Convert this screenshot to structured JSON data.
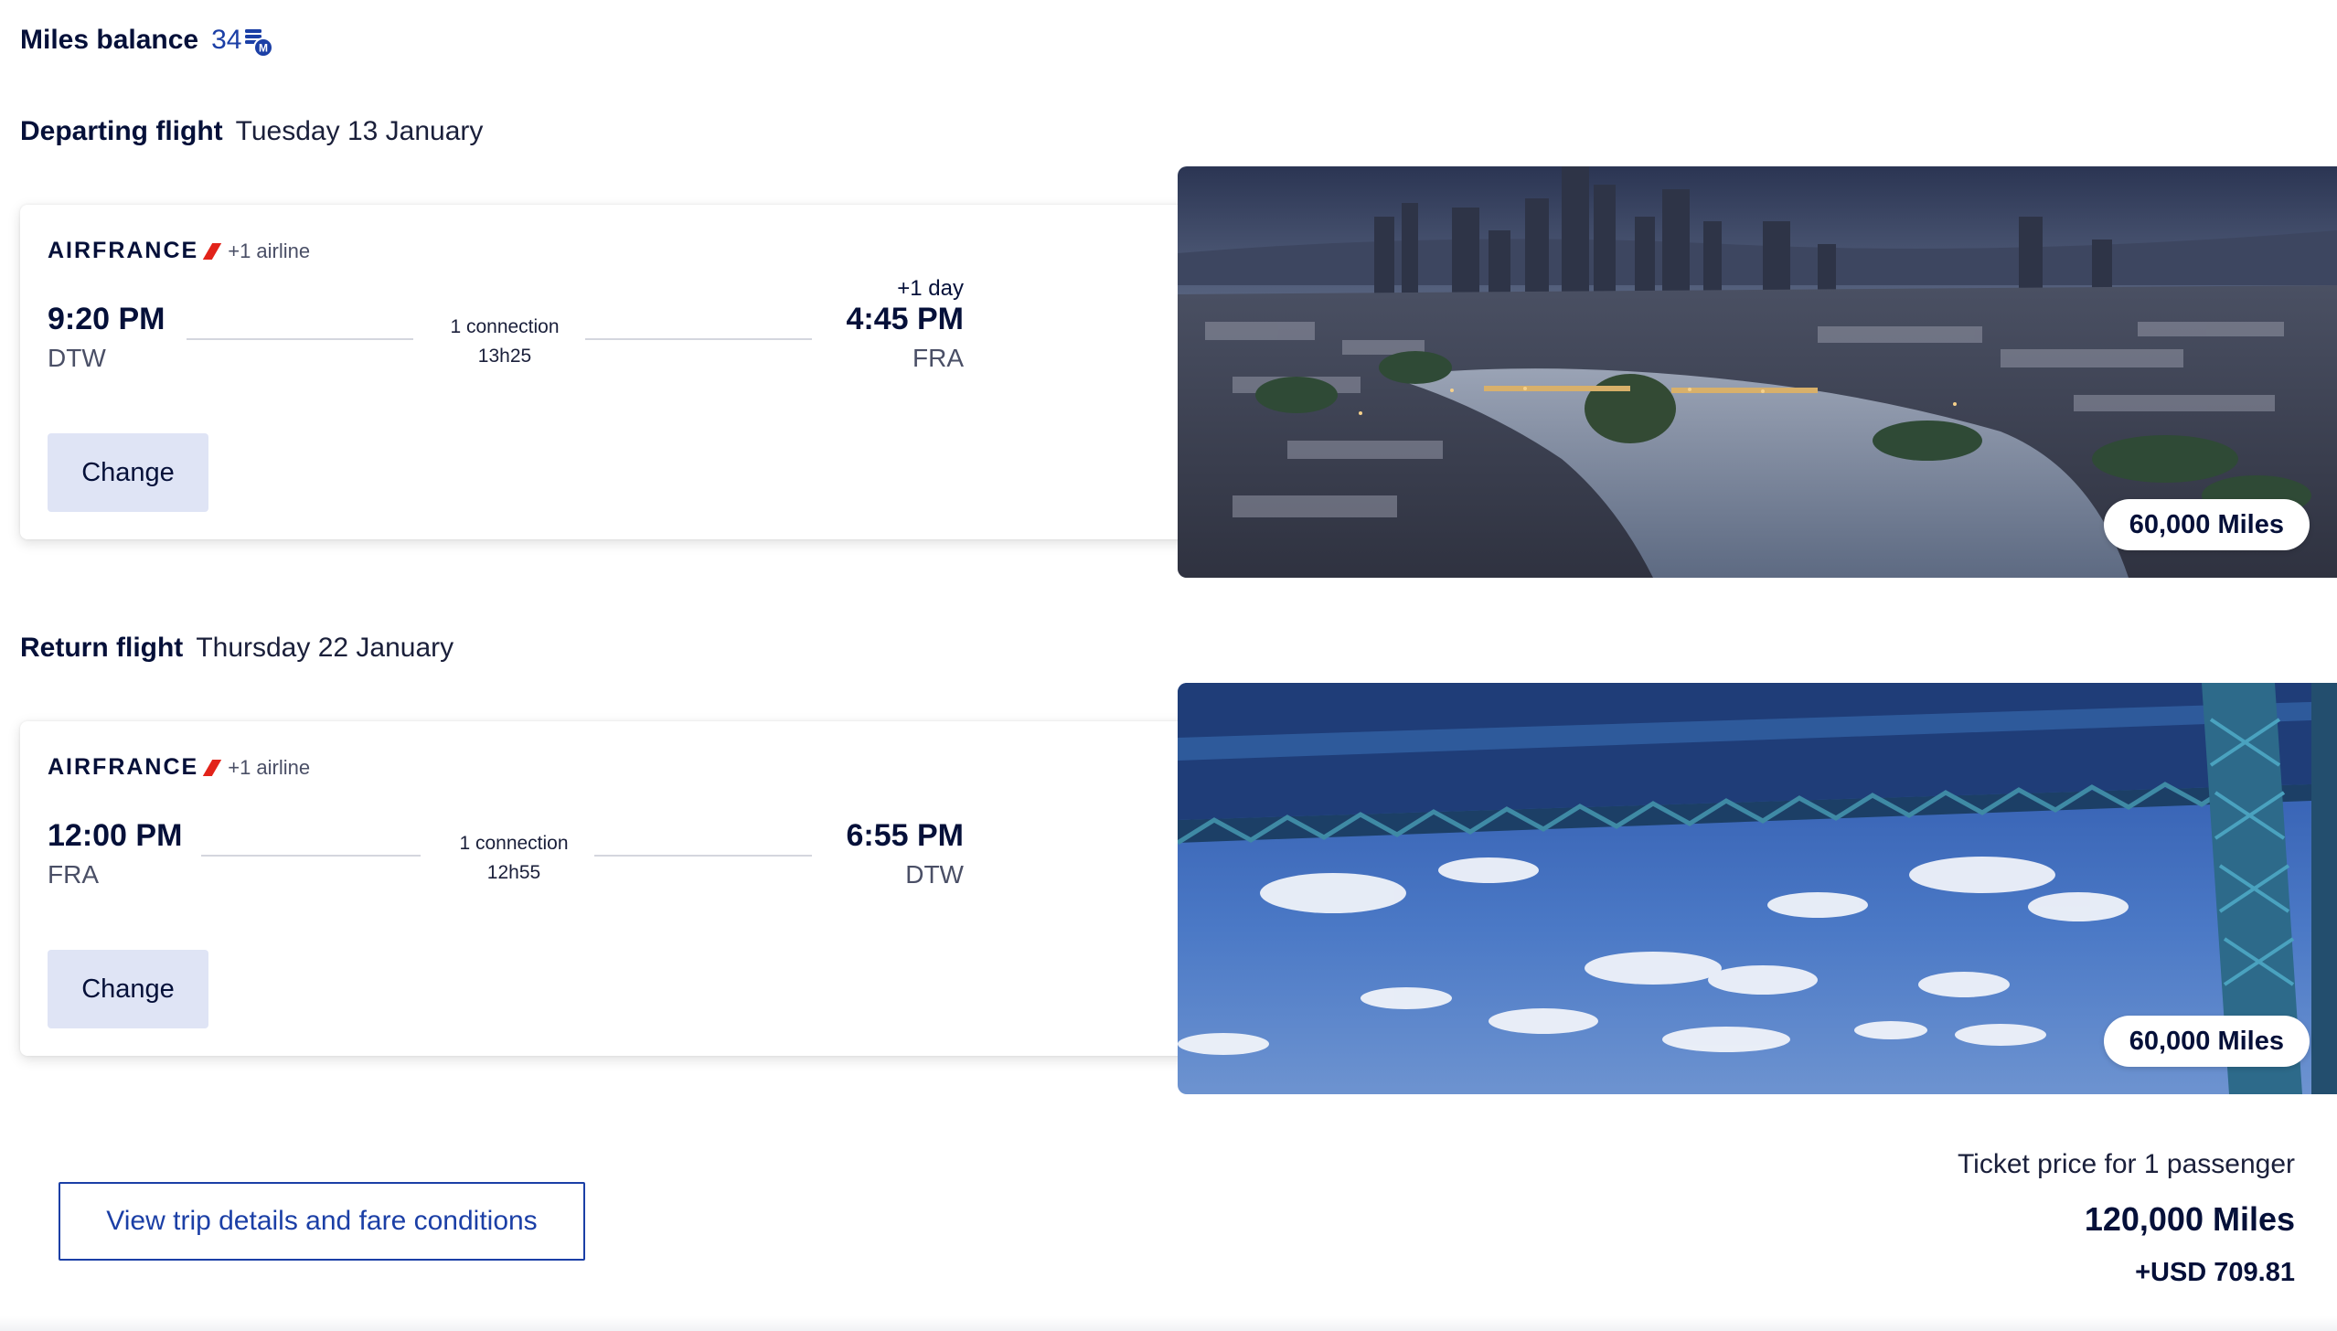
{
  "miles_balance": {
    "label": "Miles balance",
    "value": "34",
    "icon": "miles-coin-icon",
    "accent_color": "#1b3fa6"
  },
  "departing": {
    "title": "Departing flight",
    "date": "Tuesday 13 January",
    "airline_logo": "AIRFRANCE",
    "extra_airline": "+1 airline",
    "dep_time": "9:20 PM",
    "dep_code": "DTW",
    "connection": "1 connection",
    "duration": "13h25",
    "day_offset": "+1 day",
    "arr_time": "4:45 PM",
    "arr_code": "FRA",
    "change_label": "Change",
    "image": "frankfurt-skyline-photo",
    "miles_price": "60,000 Miles"
  },
  "return": {
    "title": "Return flight",
    "date": "Thursday 22 January",
    "airline_logo": "AIRFRANCE",
    "extra_airline": "+1 airline",
    "dep_time": "12:00 PM",
    "dep_code": "FRA",
    "connection": "1 connection",
    "duration": "12h55",
    "arr_time": "6:55 PM",
    "arr_code": "DTW",
    "change_label": "Change",
    "image": "detroit-bridge-photo",
    "miles_price": "60,000 Miles"
  },
  "footer": {
    "details_label": "View trip details and fare conditions",
    "price_label": "Ticket price for 1 passenger",
    "total_miles": "120,000 Miles",
    "total_cash": "+USD 709.81"
  }
}
